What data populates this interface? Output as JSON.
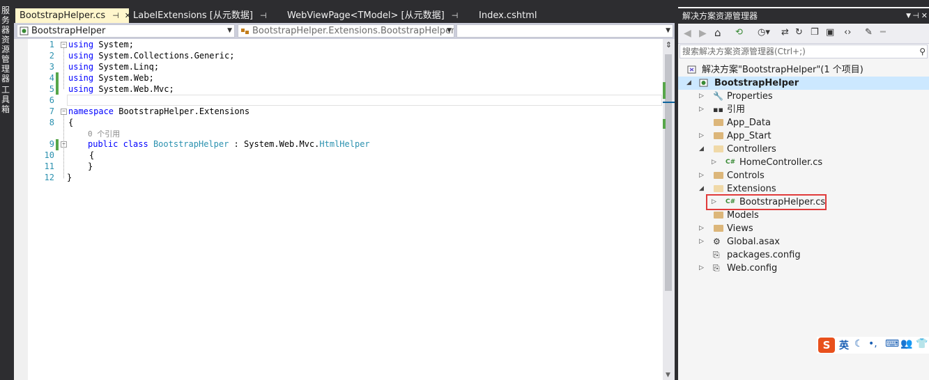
{
  "left_panel": {
    "server_explorer": "服务器资源管理器",
    "toolbox": "工具箱"
  },
  "tabs": [
    {
      "label": "BootstrapHelper.cs",
      "active": true
    },
    {
      "label": "LabelExtensions [从元数据]",
      "active": false
    },
    {
      "label": "WebViewPage<TModel> [从元数据]",
      "active": false
    },
    {
      "label": "Index.cshtml",
      "active": false
    }
  ],
  "navbar": {
    "project": "BootstrapHelper",
    "type": "BootstrapHelper.Extensions.BootstrapHelper",
    "member": ""
  },
  "code": {
    "line_numbers": [
      "1",
      "2",
      "3",
      "4",
      "5",
      "6",
      "7",
      "8",
      "9",
      "10",
      "11",
      "12"
    ],
    "kw_using": "using",
    "ns1": " System;",
    "ns2": " System.Collections.Generic;",
    "ns3": " System.Linq;",
    "ns4": " System.Web;",
    "ns5": " System.Web.Mvc;",
    "kw_namespace": "namespace",
    "ns_name": " BootstrapHelper.Extensions",
    "open_brace": "{",
    "close_brace": "}",
    "refs": "0 个引用",
    "kw_public": "public",
    "kw_class": "class",
    "class_name": "BootstrapHelper",
    "colon": " : ",
    "base_ns": "System.Web.Mvc.",
    "base_type": "HtmlHelper"
  },
  "solution_explorer": {
    "title": "解决方案资源管理器",
    "search_placeholder": "搜索解决方案资源管理器(Ctrl+;)",
    "solution": "解决方案\"BootstrapHelper\"(1 个项目)",
    "project": "BootstrapHelper",
    "items": {
      "properties": "Properties",
      "references": "引用",
      "app_data": "App_Data",
      "app_start": "App_Start",
      "controllers": "Controllers",
      "home_controller": "HomeController.cs",
      "controls": "Controls",
      "extensions": "Extensions",
      "bootstrap_helper": "BootstrapHelper.cs",
      "models": "Models",
      "views": "Views",
      "global": "Global.asax",
      "packages": "packages.config",
      "webconfig": "Web.config"
    }
  },
  "ime": {
    "lang": "英"
  },
  "colors": {
    "keyword": "#0000ff",
    "type": "#2b91af",
    "active_tab": "#fff6cc",
    "change_bar": "#57a64a",
    "highlight_border": "#e03a3a"
  }
}
